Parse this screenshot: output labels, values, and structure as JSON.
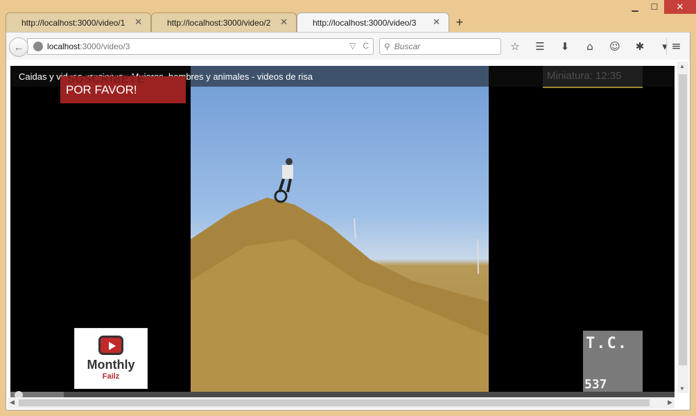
{
  "window": {
    "minimize": "▁",
    "maximize": "☐",
    "close": "✕"
  },
  "tabs": [
    {
      "label": "http://localhost:3000/video/1",
      "close": "✕"
    },
    {
      "label": "http://localhost:3000/video/2",
      "close": "✕"
    },
    {
      "label": "http://localhost:3000/video/3",
      "close": "✕",
      "active": true
    }
  ],
  "new_tab": "+",
  "toolbar": {
    "back": "←",
    "url_host": "localhost",
    "url_rest": ":3000/video/3",
    "dropdown": "▽",
    "reload": "C",
    "search_placeholder": "Buscar",
    "icons": [
      "star-icon",
      "reading-list-icon",
      "download-icon",
      "home-icon",
      "chat-icon",
      "extension-icon",
      "dropdown-icon"
    ],
    "icon_glyphs": [
      "☆",
      "☰",
      "⬇",
      "⌂",
      "☺",
      "✱",
      "▾"
    ],
    "menu": "≡"
  },
  "video": {
    "title": "Caidas y videos graciosos - Mujeres, hombres y animales - videos de risa",
    "subscribe_ghost": "SUSCRÍBETE",
    "subscribe_text": "POR FAVOR!",
    "thumbnail_label": "Miniatura: 12:35",
    "brand_line1": "Monthly",
    "brand_line2": "Failz",
    "tc_logo": "T.C.",
    "tc_number": "537",
    "progress_fraction": 0.08
  }
}
